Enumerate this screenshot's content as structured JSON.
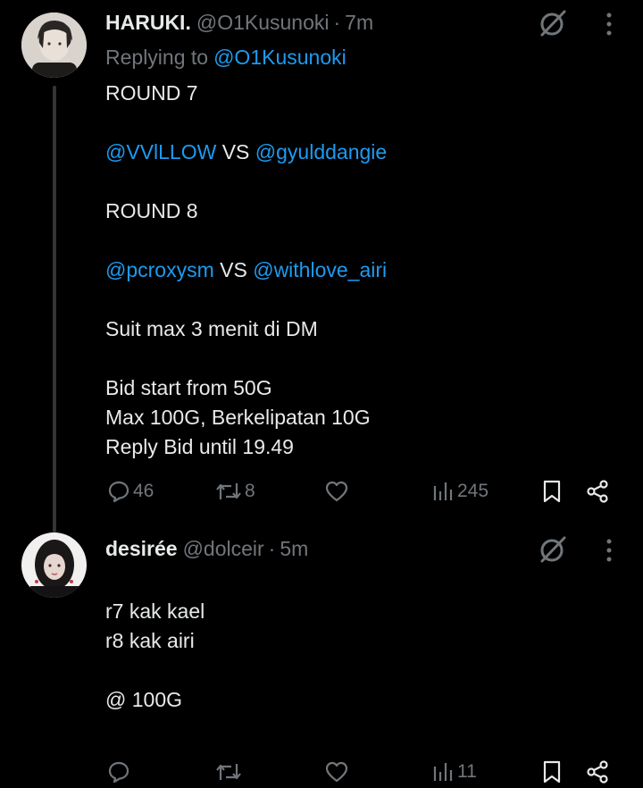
{
  "tweets": [
    {
      "display_name": "HARUKI.",
      "handle": "@O1Kusunoki",
      "separator": "·",
      "time": "7m",
      "replying_label": "Replying to",
      "replying_to": "@O1Kusunoki",
      "lines": [
        {
          "text": "ROUND 7"
        },
        {
          "text": ""
        },
        {
          "m1": "@VVlLLOW",
          "vs": " VS ",
          "m2": "@gyulddangie"
        },
        {
          "text": ""
        },
        {
          "text": "ROUND 8"
        },
        {
          "text": ""
        },
        {
          "m1": "@pcroxysm",
          "vs": " VS ",
          "m2": "@withlove_airi"
        },
        {
          "text": ""
        },
        {
          "text": "Suit max 3 menit di DM"
        },
        {
          "text": ""
        },
        {
          "text": "Bid start from 50G"
        },
        {
          "text": "Max 100G, Berkelipatan 10G"
        },
        {
          "text": "Reply Bid until 19.49"
        }
      ],
      "actions": {
        "replies": "46",
        "reposts": "8",
        "likes": "",
        "views": "245"
      }
    },
    {
      "display_name": "desirée",
      "handle": "@dolceir",
      "separator": "·",
      "time": "5m",
      "lines": [
        {
          "text": ""
        },
        {
          "text": "r7 kak kael"
        },
        {
          "text": "r8 kak airi"
        },
        {
          "text": ""
        },
        {
          "text": "@ 100G"
        }
      ],
      "actions": {
        "replies": "",
        "reposts": "",
        "likes": "",
        "views": "11"
      }
    }
  ],
  "icons": [
    "grok-icon",
    "more-icon",
    "reply-icon",
    "repost-icon",
    "like-icon",
    "views-icon",
    "bookmark-icon",
    "share-icon"
  ],
  "colors": {
    "background": "#000000",
    "text": "#e7e9ea",
    "secondary": "#71767b",
    "mention": "#1d9bf0",
    "thread_line": "#333639"
  }
}
